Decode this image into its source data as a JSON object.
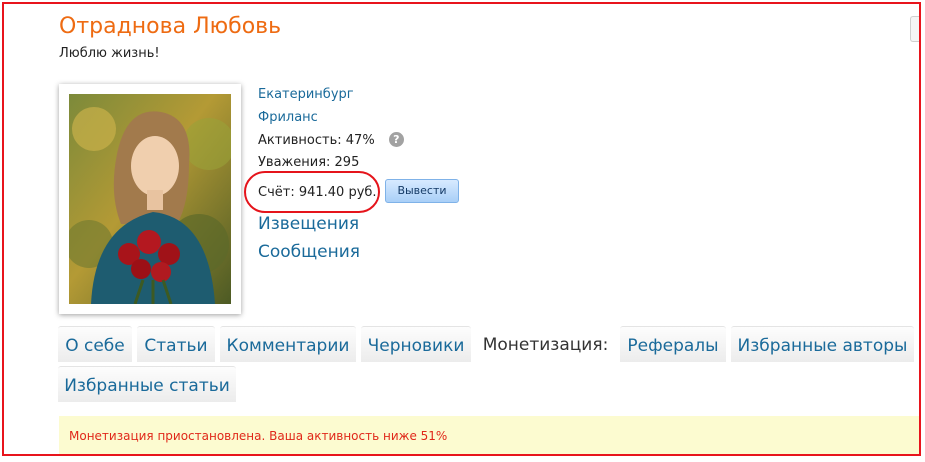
{
  "profile": {
    "name": "Отраднова Любовь",
    "status": "Люблю жизнь!"
  },
  "info": {
    "city": "Екатеринбург",
    "occupation": "Фриланс",
    "activity": "Активность: 47%",
    "respect": "Уважения: 295",
    "balance": "Счёт: 941.40 руб.",
    "withdraw_label": "Вывести",
    "help_glyph": "?",
    "help_icon": "question-circle-icon"
  },
  "links": {
    "notifications": "Извещения",
    "messages": "Сообщения"
  },
  "tabs": [
    {
      "label": "О себе"
    },
    {
      "label": "Статьи"
    },
    {
      "label": "Комментарии"
    },
    {
      "label": "Черновики"
    },
    {
      "label": "Монетизация:",
      "active": true
    },
    {
      "label": "Рефералы"
    },
    {
      "label": "Избранные авторы"
    },
    {
      "label": "Избранные статьи"
    }
  ],
  "notice": {
    "text": "Монетизация приостановлена. Ваша активность ниже 51%"
  },
  "colors": {
    "name": "#ee6b12",
    "link": "#1a6a9a",
    "annotation": "#e5141b",
    "notice_bg": "#fcfbd0",
    "notice_text": "#e0281a"
  }
}
